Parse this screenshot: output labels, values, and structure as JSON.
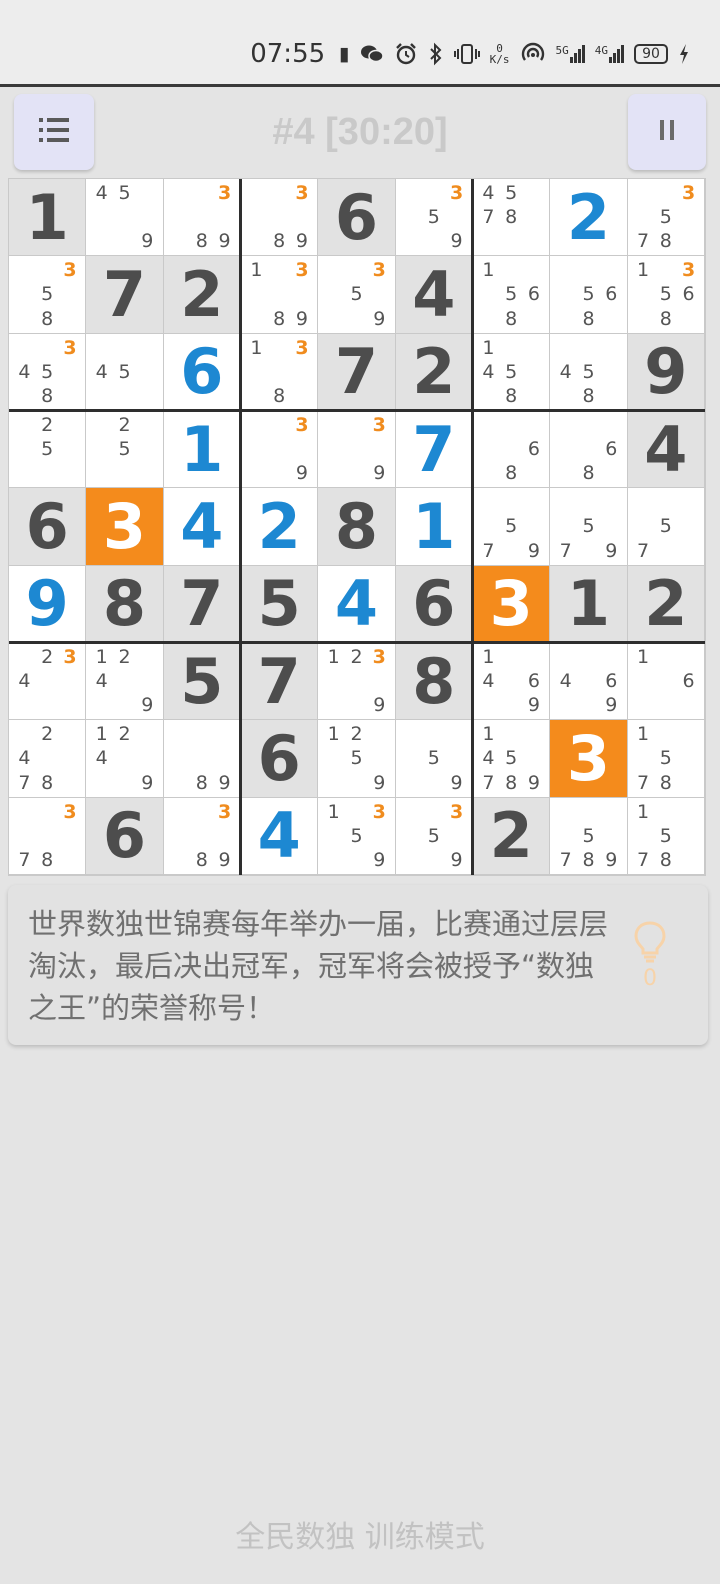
{
  "status_bar": {
    "time": "07:55",
    "net_speed_value": "0",
    "net_speed_unit": "K/s",
    "sig1_label": "5G",
    "sig2_label": "4G",
    "battery": "90",
    "icons": [
      "notification-icon",
      "wechat-icon",
      "alarm-icon",
      "bluetooth-icon",
      "vibrate-icon",
      "hotspot-icon",
      "signal-icon",
      "battery-icon",
      "charging-icon"
    ]
  },
  "header": {
    "title": "#4 [30:20]",
    "menu_icon": "list-icon",
    "pause_icon": "pause-icon"
  },
  "colors": {
    "given_bg": "#e2e2e2",
    "highlight": "#f48b1c",
    "blue": "#1d88d2",
    "orange_note": "#f08c1e"
  },
  "board": {
    "cells": [
      [
        {
          "v": "1",
          "t": "g"
        },
        {
          "n": [
            "4",
            "5",
            "",
            "",
            "",
            "",
            "",
            "",
            "9"
          ]
        },
        {
          "n": [
            "",
            "",
            "3",
            "",
            "",
            "",
            "",
            "8",
            "9"
          ],
          "o": [
            2
          ]
        },
        {
          "n": [
            "",
            "",
            "3",
            "",
            "",
            "",
            "",
            "8",
            "9"
          ],
          "o": [
            2
          ]
        },
        {
          "v": "6",
          "t": "g"
        },
        {
          "n": [
            "",
            "",
            "3",
            "",
            "5",
            "",
            "",
            "",
            "9"
          ],
          "o": [
            2
          ]
        },
        {
          "n": [
            "4",
            "5",
            "",
            "7",
            "8",
            "",
            "",
            "",
            ""
          ]
        },
        {
          "v": "2",
          "t": "b"
        },
        {
          "n": [
            "",
            "",
            "3",
            "",
            "5",
            "",
            "7",
            "8",
            ""
          ],
          "o": [
            2
          ]
        }
      ],
      [
        {
          "n": [
            "",
            "",
            "3",
            "",
            "5",
            "",
            "",
            "8",
            ""
          ],
          "o": [
            2
          ]
        },
        {
          "v": "7",
          "t": "g"
        },
        {
          "v": "2",
          "t": "g"
        },
        {
          "n": [
            "1",
            "",
            "3",
            "",
            "",
            "",
            "",
            "8",
            "9"
          ],
          "o": [
            2
          ]
        },
        {
          "n": [
            "",
            "",
            "3",
            "",
            "5",
            "",
            "",
            "",
            "9"
          ],
          "o": [
            2
          ]
        },
        {
          "v": "4",
          "t": "g"
        },
        {
          "n": [
            "1",
            "",
            "",
            "",
            "5",
            "6",
            "",
            "8",
            ""
          ]
        },
        {
          "n": [
            "",
            "",
            "",
            "",
            "5",
            "6",
            "",
            "8",
            ""
          ]
        },
        {
          "n": [
            "1",
            "",
            "3",
            "",
            "5",
            "6",
            "",
            "8",
            ""
          ],
          "o": [
            2
          ]
        }
      ],
      [
        {
          "n": [
            "",
            "",
            "3",
            "4",
            "5",
            "",
            "",
            "8",
            ""
          ],
          "o": [
            2
          ]
        },
        {
          "n": [
            "",
            "",
            "",
            "4",
            "5",
            "",
            "",
            "",
            ""
          ]
        },
        {
          "v": "6",
          "t": "b"
        },
        {
          "n": [
            "1",
            "",
            "3",
            "",
            "",
            "",
            "",
            "8",
            ""
          ],
          "o": [
            2
          ]
        },
        {
          "v": "7",
          "t": "g"
        },
        {
          "v": "2",
          "t": "g"
        },
        {
          "n": [
            "1",
            "",
            "",
            "4",
            "5",
            "",
            "",
            "8",
            ""
          ]
        },
        {
          "n": [
            "",
            "",
            "",
            "4",
            "5",
            "",
            "",
            "8",
            ""
          ]
        },
        {
          "v": "9",
          "t": "g"
        }
      ],
      [
        {
          "n": [
            "",
            "2",
            "",
            "",
            "5",
            "",
            "",
            "",
            ""
          ]
        },
        {
          "n": [
            "",
            "2",
            "",
            "",
            "5",
            "",
            "",
            "",
            ""
          ]
        },
        {
          "v": "1",
          "t": "b"
        },
        {
          "n": [
            "",
            "",
            "3",
            "",
            "",
            "",
            "",
            "",
            "9"
          ],
          "o": [
            2
          ]
        },
        {
          "n": [
            "",
            "",
            "3",
            "",
            "",
            "",
            "",
            "",
            "9"
          ],
          "o": [
            2
          ]
        },
        {
          "v": "7",
          "t": "b"
        },
        {
          "n": [
            "",
            "",
            "",
            "",
            "",
            "6",
            "",
            "8",
            ""
          ]
        },
        {
          "n": [
            "",
            "",
            "",
            "",
            "",
            "6",
            "",
            "8",
            ""
          ]
        },
        {
          "v": "4",
          "t": "g"
        }
      ],
      [
        {
          "v": "6",
          "t": "g"
        },
        {
          "v": "3",
          "t": "h"
        },
        {
          "v": "4",
          "t": "b"
        },
        {
          "v": "2",
          "t": "b"
        },
        {
          "v": "8",
          "t": "g"
        },
        {
          "v": "1",
          "t": "b"
        },
        {
          "n": [
            "",
            "",
            "",
            "",
            "5",
            "",
            "7",
            "",
            "9"
          ]
        },
        {
          "n": [
            "",
            "",
            "",
            "",
            "5",
            "",
            "7",
            "",
            "9"
          ]
        },
        {
          "n": [
            "",
            "",
            "",
            "",
            "5",
            "",
            "7",
            "",
            ""
          ]
        }
      ],
      [
        {
          "v": "9",
          "t": "b"
        },
        {
          "v": "8",
          "t": "g"
        },
        {
          "v": "7",
          "t": "g"
        },
        {
          "v": "5",
          "t": "g"
        },
        {
          "v": "4",
          "t": "b"
        },
        {
          "v": "6",
          "t": "g"
        },
        {
          "v": "3",
          "t": "h"
        },
        {
          "v": "1",
          "t": "g"
        },
        {
          "v": "2",
          "t": "g"
        }
      ],
      [
        {
          "n": [
            "",
            "2",
            "3",
            "4",
            "",
            "",
            "",
            "",
            ""
          ],
          "o": [
            2
          ]
        },
        {
          "n": [
            "1",
            "2",
            "",
            "4",
            "",
            "",
            "",
            "",
            "9"
          ]
        },
        {
          "v": "5",
          "t": "g"
        },
        {
          "v": "7",
          "t": "g"
        },
        {
          "n": [
            "1",
            "2",
            "3",
            "",
            "",
            "",
            "",
            "",
            "9"
          ],
          "o": [
            2
          ]
        },
        {
          "v": "8",
          "t": "g"
        },
        {
          "n": [
            "1",
            "",
            "",
            "4",
            "",
            "6",
            "",
            "",
            "9"
          ]
        },
        {
          "n": [
            "",
            "",
            "",
            "4",
            "",
            "6",
            "",
            "",
            "9"
          ]
        },
        {
          "n": [
            "1",
            "",
            "",
            "",
            "",
            "6",
            "",
            "",
            ""
          ]
        }
      ],
      [
        {
          "n": [
            "",
            "2",
            "",
            "4",
            "",
            "",
            "7",
            "8",
            ""
          ]
        },
        {
          "n": [
            "1",
            "2",
            "",
            "4",
            "",
            "",
            "",
            "",
            "9"
          ]
        },
        {
          "n": [
            "",
            "",
            "",
            "",
            "",
            "",
            "",
            "8",
            "9"
          ]
        },
        {
          "v": "6",
          "t": "g"
        },
        {
          "n": [
            "1",
            "2",
            "",
            "",
            "5",
            "",
            "",
            "",
            "9"
          ]
        },
        {
          "n": [
            "",
            "",
            "",
            "",
            "5",
            "",
            "",
            "",
            "9"
          ]
        },
        {
          "n": [
            "1",
            "",
            "",
            "4",
            "5",
            "",
            "7",
            "8",
            "9"
          ]
        },
        {
          "v": "3",
          "t": "h"
        },
        {
          "n": [
            "1",
            "",
            "",
            "",
            "5",
            "",
            "7",
            "8",
            ""
          ]
        }
      ],
      [
        {
          "n": [
            "",
            "",
            "3",
            "",
            "",
            "",
            "7",
            "8",
            ""
          ],
          "o": [
            2
          ]
        },
        {
          "v": "6",
          "t": "g"
        },
        {
          "n": [
            "",
            "",
            "3",
            "",
            "",
            "",
            "",
            "8",
            "9"
          ],
          "o": [
            2
          ]
        },
        {
          "v": "4",
          "t": "b"
        },
        {
          "n": [
            "1",
            "",
            "3",
            "",
            "5",
            "",
            "",
            "",
            "9"
          ],
          "o": [
            2
          ]
        },
        {
          "n": [
            "",
            "",
            "3",
            "",
            "5",
            "",
            "",
            "",
            "9"
          ],
          "o": [
            2
          ]
        },
        {
          "v": "2",
          "t": "g"
        },
        {
          "n": [
            "",
            "",
            "",
            "",
            "5",
            "",
            "7",
            "8",
            "9"
          ]
        },
        {
          "n": [
            "1",
            "",
            "",
            "",
            "5",
            "",
            "7",
            "8",
            ""
          ]
        }
      ]
    ]
  },
  "tip": {
    "text": "世界数独世锦赛每年举办一届，比赛通过层层淘汰，最后决出冠军，冠军将会被授予“数独之王”的荣誉称号！",
    "hint_icon": "lightbulb-icon",
    "hint_count": "0"
  },
  "footer": {
    "text": "全民数独 训练模式"
  }
}
